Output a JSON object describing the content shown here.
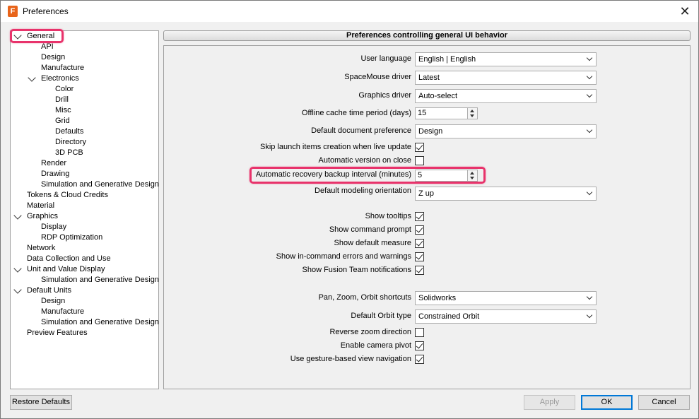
{
  "window": {
    "title": "Preferences",
    "app_icon_letter": "F"
  },
  "tree": [
    {
      "label": "General",
      "level": 0,
      "expanded": true
    },
    {
      "label": "API",
      "level": 1
    },
    {
      "label": "Design",
      "level": 1
    },
    {
      "label": "Manufacture",
      "level": 1
    },
    {
      "label": "Electronics",
      "level": 1,
      "expanded": true
    },
    {
      "label": "Color",
      "level": 2
    },
    {
      "label": "Drill",
      "level": 2
    },
    {
      "label": "Misc",
      "level": 2
    },
    {
      "label": "Grid",
      "level": 2
    },
    {
      "label": "Defaults",
      "level": 2
    },
    {
      "label": "Directory",
      "level": 2
    },
    {
      "label": "3D PCB",
      "level": 2
    },
    {
      "label": "Render",
      "level": 1
    },
    {
      "label": "Drawing",
      "level": 1
    },
    {
      "label": "Simulation and Generative Design",
      "level": 1
    },
    {
      "label": "Tokens & Cloud Credits",
      "level": 0
    },
    {
      "label": "Material",
      "level": 0
    },
    {
      "label": "Graphics",
      "level": 0,
      "expanded": true
    },
    {
      "label": "Display",
      "level": 1
    },
    {
      "label": "RDP Optimization",
      "level": 1
    },
    {
      "label": "Network",
      "level": 0
    },
    {
      "label": "Data Collection and Use",
      "level": 0
    },
    {
      "label": "Unit and Value Display",
      "level": 0,
      "expanded": true
    },
    {
      "label": "Simulation and Generative Design",
      "level": 1
    },
    {
      "label": "Default Units",
      "level": 0,
      "expanded": true
    },
    {
      "label": "Design",
      "level": 1
    },
    {
      "label": "Manufacture",
      "level": 1
    },
    {
      "label": "Simulation and Generative Design",
      "level": 1
    },
    {
      "label": "Preview Features",
      "level": 0
    }
  ],
  "panel_title": "Preferences controlling general UI behavior",
  "settings": {
    "user_language": {
      "label": "User language",
      "value": "English | English"
    },
    "spacemouse": {
      "label": "SpaceMouse driver",
      "value": "Latest"
    },
    "graphics_driver": {
      "label": "Graphics driver",
      "value": "Auto-select"
    },
    "offline_cache": {
      "label": "Offline cache time period (days)",
      "value": "15"
    },
    "default_doc": {
      "label": "Default document preference",
      "value": "Design"
    },
    "skip_launch": {
      "label": "Skip launch items creation when live update",
      "checked": true
    },
    "auto_version": {
      "label": "Automatic version on close",
      "checked": false
    },
    "auto_recovery": {
      "label": "Automatic recovery backup interval (minutes)",
      "value": "5"
    },
    "modeling_orientation": {
      "label": "Default modeling orientation",
      "value": "Z up"
    },
    "show_tooltips": {
      "label": "Show tooltips",
      "checked": true
    },
    "show_cmd_prompt": {
      "label": "Show command prompt",
      "checked": true
    },
    "show_default_measure": {
      "label": "Show default measure",
      "checked": true
    },
    "show_errors": {
      "label": "Show in-command errors and warnings",
      "checked": true
    },
    "show_team_notif": {
      "label": "Show Fusion Team notifications",
      "checked": true
    },
    "pan_zoom": {
      "label": "Pan, Zoom, Orbit shortcuts",
      "value": "Solidworks"
    },
    "orbit_type": {
      "label": "Default Orbit type",
      "value": "Constrained Orbit"
    },
    "reverse_zoom": {
      "label": "Reverse zoom direction",
      "checked": false
    },
    "camera_pivot": {
      "label": "Enable camera pivot",
      "checked": true
    },
    "gesture_nav": {
      "label": "Use gesture-based view navigation",
      "checked": true
    }
  },
  "buttons": {
    "restore": "Restore Defaults",
    "apply": "Apply",
    "ok": "OK",
    "cancel": "Cancel"
  },
  "colors": {
    "highlight": "#e8336b",
    "accent": "#0078d7",
    "app_icon": "#e8641a"
  }
}
